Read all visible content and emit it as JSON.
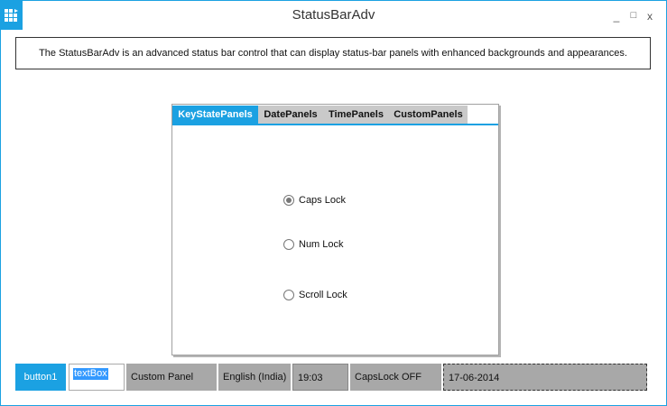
{
  "window": {
    "title": "StatusBarAdv",
    "minimize_glyph": "_",
    "maximize_glyph": "□",
    "close_glyph": "x",
    "accent_color": "#1ba1e2"
  },
  "description": "The StatusBarAdv is an advanced status bar control that can display status-bar panels with enhanced backgrounds and appearances.",
  "tabs": [
    {
      "label": "KeyStatePanels",
      "active": true
    },
    {
      "label": "DatePanels",
      "active": false
    },
    {
      "label": "TimePanels",
      "active": false
    },
    {
      "label": "CustomPanels",
      "active": false
    }
  ],
  "radios": [
    {
      "label": "Caps Lock",
      "checked": true
    },
    {
      "label": "Num Lock",
      "checked": false
    },
    {
      "label": "Scroll Lock",
      "checked": false
    }
  ],
  "statusbar": {
    "button_label": "button1",
    "textbox_value": "textBox",
    "custom_panel": "Custom Panel",
    "language_panel": "English (India)",
    "time_panel": "19:03",
    "capslock_panel": "CapsLock OFF",
    "date_panel": "17-06-2014"
  }
}
